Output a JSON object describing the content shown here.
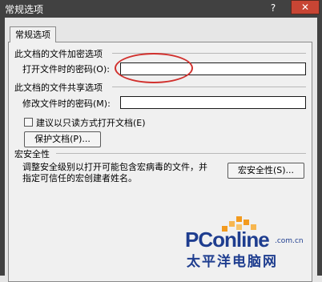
{
  "window": {
    "title": "常规选项",
    "help_label": "?",
    "close_label": "✕"
  },
  "tab": {
    "label": "常规选项"
  },
  "encrypt_section": {
    "title": "此文档的文件加密选项",
    "open_password_label": "打开文件时的密码",
    "open_password_key": "(O):",
    "open_password_value": ""
  },
  "share_section": {
    "title": "此文档的文件共享选项",
    "modify_password_label": "修改文件时的密码",
    "modify_password_key": "(M):",
    "modify_password_value": "",
    "readonly_label": "建议以只读方式打开文档",
    "readonly_key": "(E)",
    "readonly_checked": false,
    "protect_button_label": "保护文档",
    "protect_button_key": "(P)...",
    "protect_button_key_letter": "P"
  },
  "macro_section": {
    "title": "宏安全性",
    "description_line1": "调整安全级别以打开可能包含宏病毒的文件，并",
    "description_line2": "指定可信任的宏创建者姓名。",
    "button_label": "宏安全性",
    "button_key": "(S)..."
  },
  "watermark": {
    "brand": "PConline",
    "domain": ".com.cn",
    "chinese": "太平洋电脑网"
  },
  "colors": {
    "titlebar": "#414141",
    "close_button": "#c84534",
    "highlight_circle": "#d1302d",
    "watermark_blue": "#1e3d8f",
    "watermark_orange": "#f29a1e"
  }
}
